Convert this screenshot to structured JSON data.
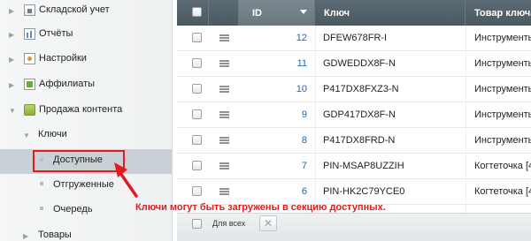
{
  "sidebar": {
    "items": [
      {
        "label": "Складской учет"
      },
      {
        "label": "Отчёты"
      },
      {
        "label": "Настройки"
      },
      {
        "label": "Аффилиаты"
      },
      {
        "label": "Продажа контента"
      },
      {
        "label": "Ключи"
      },
      {
        "label": "Доступные"
      },
      {
        "label": "Отгруженные"
      },
      {
        "label": "Очередь"
      },
      {
        "label": "Товары"
      }
    ]
  },
  "table": {
    "headers": {
      "id": "ID",
      "key": "Ключ",
      "product": "Товар ключа"
    },
    "rows": [
      {
        "id": "12",
        "key": "DFEW678FR-I",
        "product": "Инструменты"
      },
      {
        "id": "11",
        "key": "GDWEDDX8F-N",
        "product": "Инструменты"
      },
      {
        "id": "10",
        "key": "P417DX8FXZ3-N",
        "product": "Инструменты"
      },
      {
        "id": "9",
        "key": "GDP417DX8F-N",
        "product": "Инструменты"
      },
      {
        "id": "8",
        "key": "P417DX8FRD-N",
        "product": "Инструменты"
      },
      {
        "id": "7",
        "key": "PIN-MSAP8UZZIH",
        "product": "Когтеточка [4"
      },
      {
        "id": "6",
        "key": "PIN-HK2C79YCE0",
        "product": "Когтеточка [4"
      }
    ],
    "footer": {
      "for_all_label": "Для всех",
      "delete_icon": "close-icon"
    }
  },
  "annotation": {
    "text": "Ключи могут быть загружены в секцию доступных.",
    "color": "#e21c1c"
  }
}
